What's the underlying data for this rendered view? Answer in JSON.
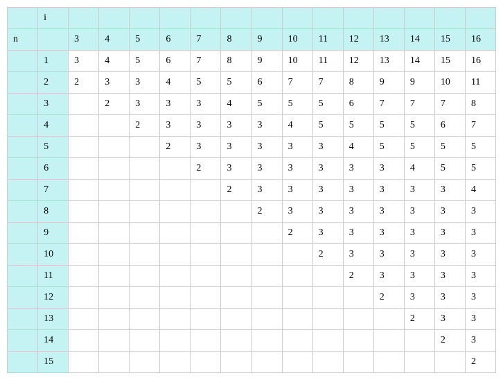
{
  "chart_data": {
    "type": "table",
    "title": "",
    "col_label": "i",
    "row_label": "n",
    "col_headers": [
      "3",
      "4",
      "5",
      "6",
      "7",
      "8",
      "9",
      "10",
      "11",
      "12",
      "13",
      "14",
      "15",
      "16"
    ],
    "row_headers": [
      "1",
      "2",
      "3",
      "4",
      "5",
      "6",
      "7",
      "8",
      "9",
      "10",
      "11",
      "12",
      "13",
      "14",
      "15"
    ],
    "rows": [
      [
        "3",
        "4",
        "5",
        "6",
        "7",
        "8",
        "9",
        "10",
        "11",
        "12",
        "13",
        "14",
        "15",
        "16"
      ],
      [
        "2",
        "3",
        "3",
        "4",
        "5",
        "5",
        "6",
        "7",
        "7",
        "8",
        "9",
        "9",
        "10",
        "11"
      ],
      [
        "",
        "2",
        "3",
        "3",
        "3",
        "4",
        "5",
        "5",
        "5",
        "6",
        "7",
        "7",
        "7",
        "8"
      ],
      [
        "",
        "",
        "2",
        "3",
        "3",
        "3",
        "3",
        "4",
        "5",
        "5",
        "5",
        "5",
        "6",
        "7"
      ],
      [
        "",
        "",
        "",
        "2",
        "3",
        "3",
        "3",
        "3",
        "3",
        "4",
        "5",
        "5",
        "5",
        "5"
      ],
      [
        "",
        "",
        "",
        "",
        "2",
        "3",
        "3",
        "3",
        "3",
        "3",
        "3",
        "4",
        "5",
        "5"
      ],
      [
        "",
        "",
        "",
        "",
        "",
        "2",
        "3",
        "3",
        "3",
        "3",
        "3",
        "3",
        "3",
        "4"
      ],
      [
        "",
        "",
        "",
        "",
        "",
        "",
        "2",
        "3",
        "3",
        "3",
        "3",
        "3",
        "3",
        "3"
      ],
      [
        "",
        "",
        "",
        "",
        "",
        "",
        "",
        "2",
        "3",
        "3",
        "3",
        "3",
        "3",
        "3"
      ],
      [
        "",
        "",
        "",
        "",
        "",
        "",
        "",
        "",
        "2",
        "3",
        "3",
        "3",
        "3",
        "3"
      ],
      [
        "",
        "",
        "",
        "",
        "",
        "",
        "",
        "",
        "",
        "2",
        "3",
        "3",
        "3",
        "3"
      ],
      [
        "",
        "",
        "",
        "",
        "",
        "",
        "",
        "",
        "",
        "",
        "2",
        "3",
        "3",
        "3"
      ],
      [
        "",
        "",
        "",
        "",
        "",
        "",
        "",
        "",
        "",
        "",
        "",
        "2",
        "3",
        "3"
      ],
      [
        "",
        "",
        "",
        "",
        "",
        "",
        "",
        "",
        "",
        "",
        "",
        "",
        "2",
        "3"
      ],
      [
        "",
        "",
        "",
        "",
        "",
        "",
        "",
        "",
        "",
        "",
        "",
        "",
        "",
        "2"
      ]
    ]
  }
}
